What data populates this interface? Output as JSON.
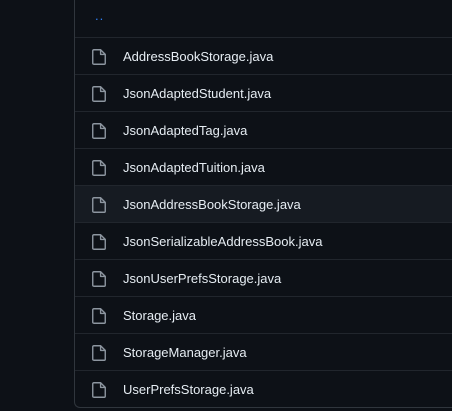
{
  "file_list": {
    "parent_link": "..",
    "files": [
      {
        "name": "AddressBookStorage.java",
        "icon": "file-icon"
      },
      {
        "name": "JsonAdaptedStudent.java",
        "icon": "file-icon"
      },
      {
        "name": "JsonAdaptedTag.java",
        "icon": "file-icon"
      },
      {
        "name": "JsonAdaptedTuition.java",
        "icon": "file-icon"
      },
      {
        "name": "JsonAddressBookStorage.java",
        "icon": "file-icon",
        "highlighted": true
      },
      {
        "name": "JsonSerializableAddressBook.java",
        "icon": "file-icon"
      },
      {
        "name": "JsonUserPrefsStorage.java",
        "icon": "file-icon"
      },
      {
        "name": "Storage.java",
        "icon": "file-icon"
      },
      {
        "name": "StorageManager.java",
        "icon": "file-icon"
      },
      {
        "name": "UserPrefsStorage.java",
        "icon": "file-icon"
      }
    ]
  },
  "colors": {
    "background": "#0d1117",
    "link": "#2f81f7",
    "text": "#e6edf3",
    "icon": "#8d96a0",
    "border": "#30363d",
    "hover": "#161b22"
  }
}
